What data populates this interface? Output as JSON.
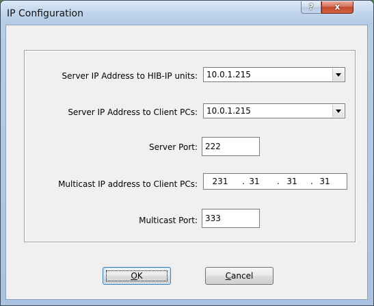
{
  "window": {
    "title": "IP Configuration",
    "help_label": "?",
    "close_label": "x"
  },
  "form": {
    "server_ip_hib": {
      "label": "Server IP Address to HIB-IP units:",
      "value": "10.0.1.215"
    },
    "server_ip_client": {
      "label": "Server IP Address to Client PCs:",
      "value": "10.0.1.215"
    },
    "server_port": {
      "label": "Server Port:",
      "value": "222"
    },
    "multicast_ip": {
      "label": "Multicast IP address to Client PCs:",
      "octets": [
        "231",
        "31",
        "31",
        "31"
      ],
      "separator": "."
    },
    "multicast_port": {
      "label": "Multicast Port:",
      "value": "333"
    }
  },
  "buttons": {
    "ok_mnemonic": "O",
    "ok_rest": "K",
    "cancel_mnemonic": "C",
    "cancel_rest": "ancel"
  },
  "colors": {
    "titlebar": "#c2d6ec",
    "close_button": "#c24a2f",
    "dialog_face": "#f0f0f0"
  }
}
